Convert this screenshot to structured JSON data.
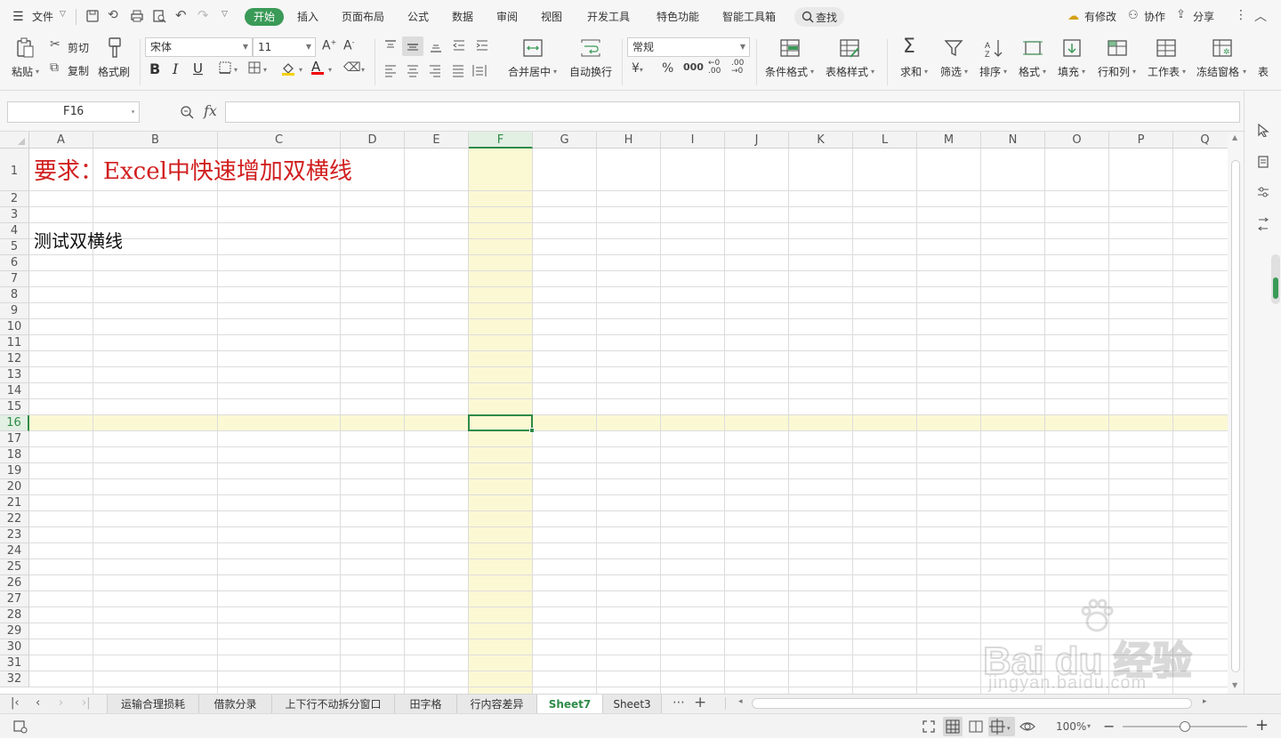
{
  "menubar": {
    "file_label": "文件",
    "tabs": [
      "开始",
      "插入",
      "页面布局",
      "公式",
      "数据",
      "审阅",
      "视图",
      "开发工具",
      "特色功能",
      "智能工具箱"
    ],
    "active_tab": "开始",
    "search_label": "查找",
    "changes_label": "有修改",
    "collab_label": "协作",
    "share_label": "分享"
  },
  "ribbon": {
    "paste": "粘贴",
    "cut": "剪切",
    "copy": "复制",
    "format_painter": "格式刷",
    "font_name": "宋体",
    "font_size": "11",
    "merge_center": "合并居中",
    "wrap_text": "自动换行",
    "number_format": "常规",
    "conditional_format": "条件格式",
    "table_style": "表格样式",
    "sum": "求和",
    "filter": "筛选",
    "sort": "排序",
    "format": "格式",
    "fill": "填充",
    "row_col": "行和列",
    "worksheet": "工作表",
    "freeze": "冻结窗格",
    "more": "表"
  },
  "formula_bar": {
    "name_box": "F16",
    "fx_label": "fx",
    "formula": ""
  },
  "columns": [
    "A",
    "B",
    "C",
    "D",
    "E",
    "F",
    "G",
    "H",
    "I",
    "J",
    "K",
    "L",
    "M",
    "N",
    "O",
    "P",
    "Q"
  ],
  "rows": [
    "1",
    "2",
    "3",
    "4",
    "5",
    "6",
    "7",
    "8",
    "9",
    "10",
    "11",
    "12",
    "13",
    "14",
    "15",
    "16",
    "17",
    "18",
    "19",
    "20",
    "21",
    "22",
    "23",
    "24",
    "25",
    "26",
    "27",
    "28",
    "29",
    "30",
    "31",
    "32"
  ],
  "cells": {
    "A1": "要求：Excel中快速增加双横线",
    "A4": "测试双横线"
  },
  "selected_cell": "F16",
  "colors": {
    "accent": "#3a9a57",
    "title_red": "#d11f1f",
    "highlight": "#fbf8d4"
  },
  "sheet_tabs": [
    "运输合理损耗",
    "借款分录",
    "上下行不动拆分窗口",
    "田字格",
    "行内容差异",
    "Sheet7",
    "Sheet3"
  ],
  "active_sheet": "Sheet7",
  "status": {
    "zoom": "100%"
  },
  "watermark": {
    "brand": "Bai du 经验",
    "url": "jingyan.baidu.com"
  }
}
